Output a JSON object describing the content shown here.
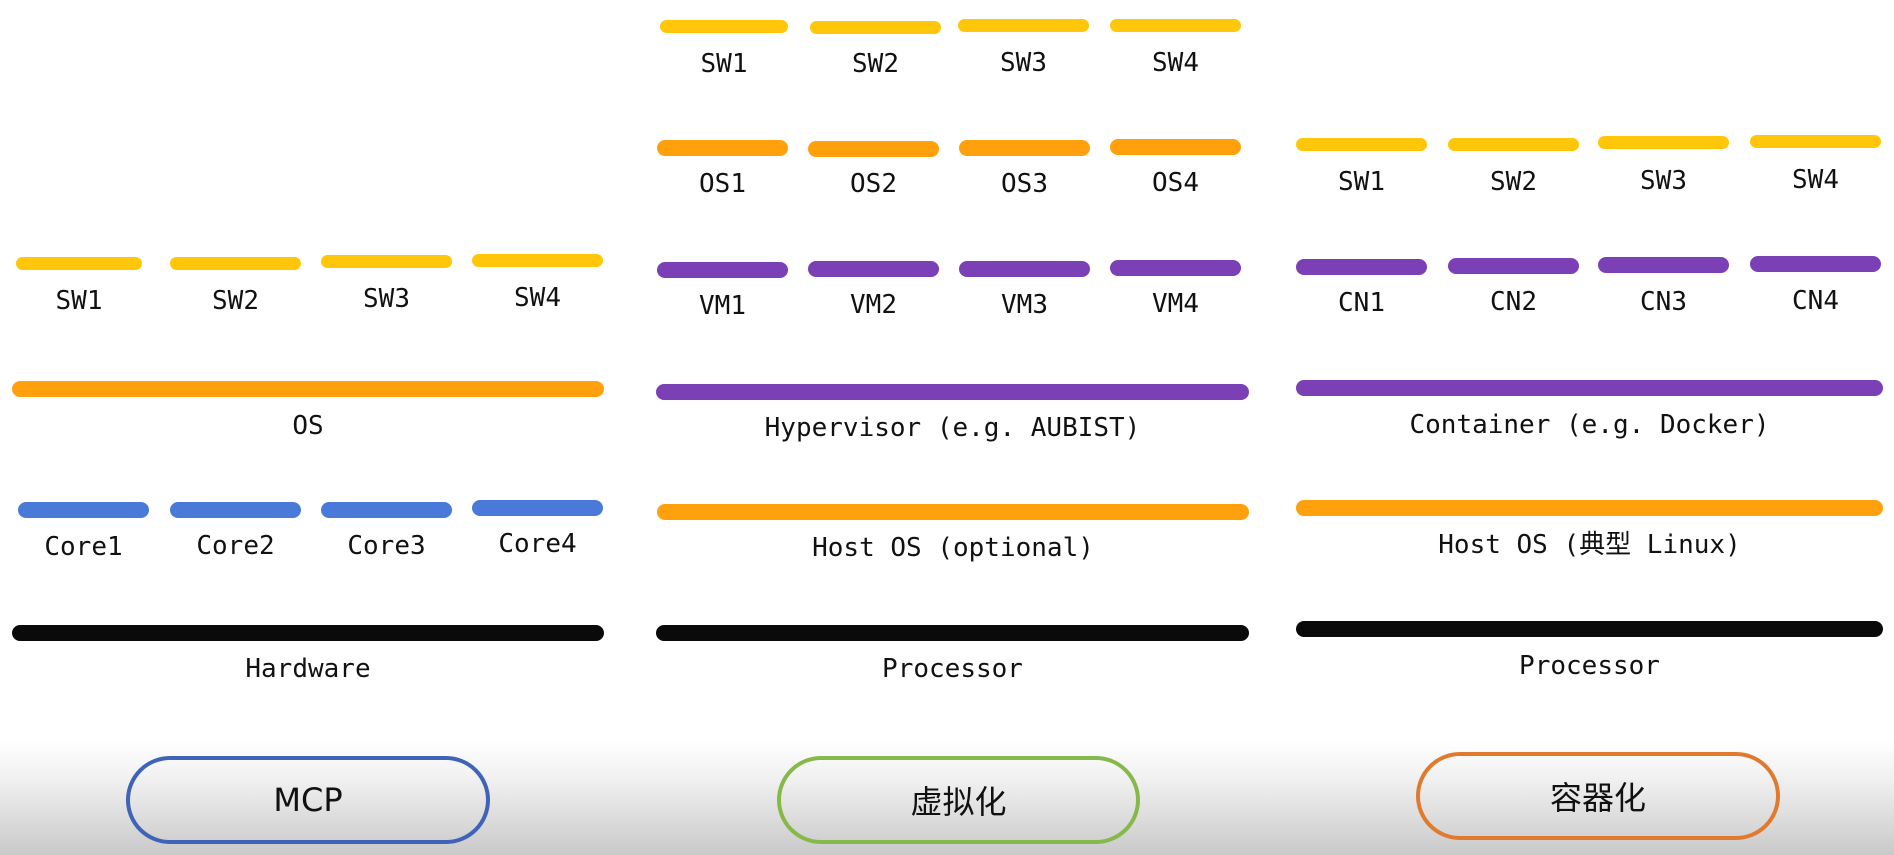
{
  "colors": {
    "software": "#ffc60a",
    "os": "#ffa00c",
    "virtual": "#7b3fb6",
    "core": "#4a7ad9",
    "hardware": "#0a0a0a",
    "mcp_border": "#3e63b8",
    "virt_border": "#86b84a",
    "container_border": "#e07a2e"
  },
  "mcp": {
    "sw": [
      "SW1",
      "SW2",
      "SW3",
      "SW4"
    ],
    "os": "OS",
    "cores": [
      "Core1",
      "Core2",
      "Core3",
      "Core4"
    ],
    "hardware": "Hardware",
    "tag": "MCP"
  },
  "virtualization": {
    "sw": [
      "SW1",
      "SW2",
      "SW3",
      "SW4"
    ],
    "guest_os": [
      "OS1",
      "OS2",
      "OS3",
      "OS4"
    ],
    "vms": [
      "VM1",
      "VM2",
      "VM3",
      "VM4"
    ],
    "hypervisor": "Hypervisor (e.g. AUBIST)",
    "host_os": "Host OS (optional)",
    "processor": "Processor",
    "tag": "虚拟化"
  },
  "containerization": {
    "sw": [
      "SW1",
      "SW2",
      "SW3",
      "SW4"
    ],
    "containers": [
      "CN1",
      "CN2",
      "CN3",
      "CN4"
    ],
    "runtime": "Container (e.g. Docker)",
    "host_os": "Host OS (典型 Linux)",
    "processor": "Processor",
    "tag": "容器化"
  }
}
